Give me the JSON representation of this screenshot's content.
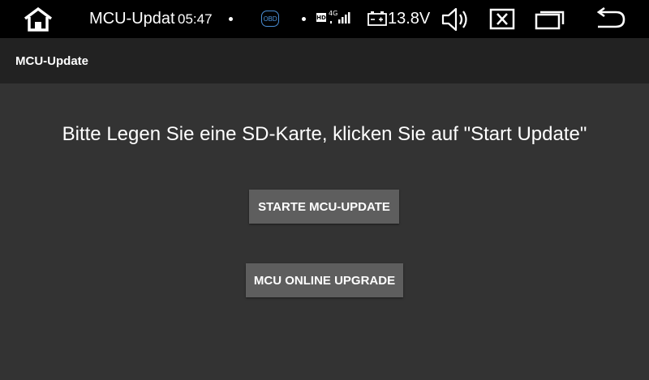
{
  "statusbar": {
    "app_title": "MCU-Updat",
    "time": "05:47",
    "obd_label": "OBD",
    "voltage": "13.8V",
    "icons": [
      "home-icon",
      "obd-icon",
      "hd-icon",
      "4g-signal-icon",
      "battery-icon",
      "volume-icon",
      "close-icon",
      "recent-apps-icon",
      "back-icon"
    ],
    "hd_label": "HD",
    "network_label": "4G"
  },
  "actionbar": {
    "title": "MCU-Update"
  },
  "main": {
    "message": "Bitte Legen Sie eine SD-Karte, klicken Sie auf \"Start Update\"",
    "start_button": "STARTE MCU-UPDATE",
    "online_button": "MCU ONLINE UPGRADE"
  },
  "colors": {
    "statusbar_bg": "#000000",
    "actionbar_bg": "#222222",
    "content_bg": "#333333",
    "button_bg": "#5e5e5e",
    "obd_accent": "#4a8fd6"
  }
}
